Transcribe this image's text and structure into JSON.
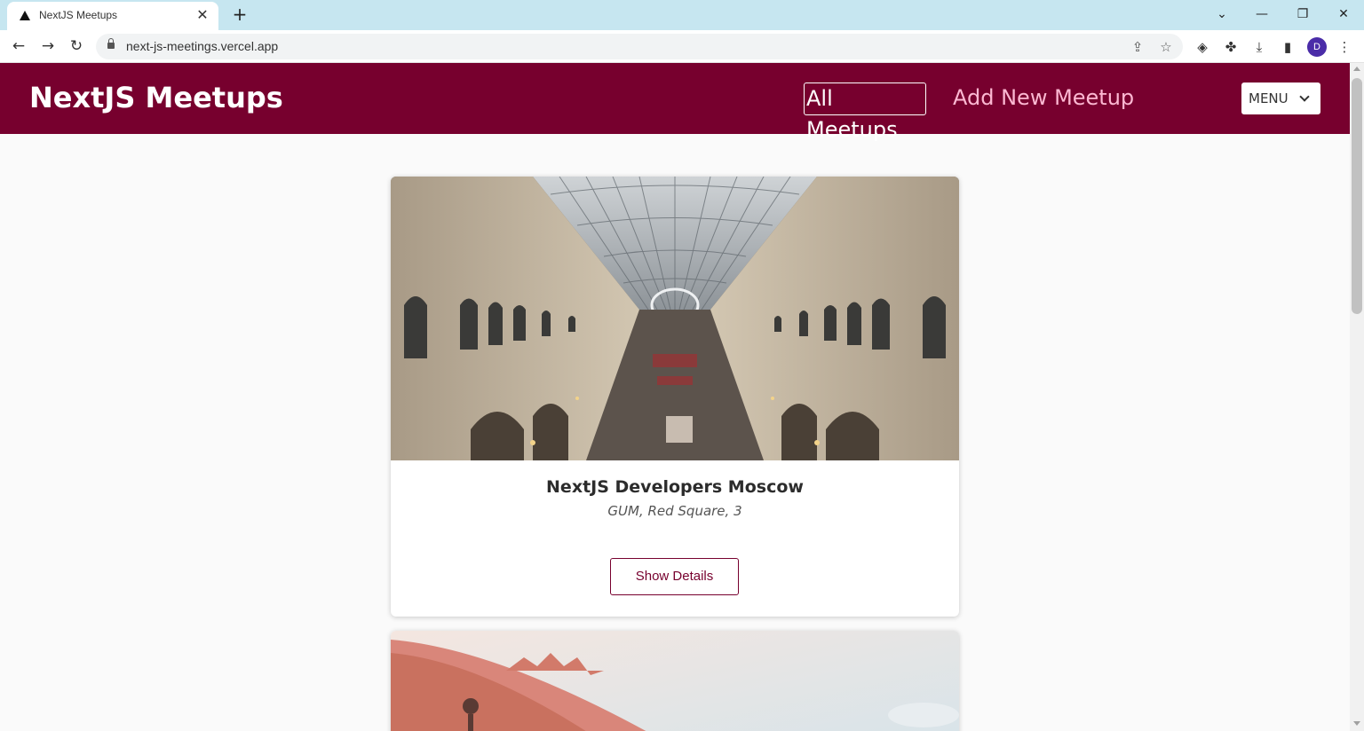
{
  "browser": {
    "tab_title": "NextJS Meetups",
    "tab_close_glyph": "✕",
    "new_tab_glyph": "+",
    "url": "next-js-meetings.vercel.app",
    "avatar_letter": "D",
    "icons": [
      "back-icon",
      "forward-icon",
      "reload-icon",
      "lock-icon",
      "share-icon",
      "star-icon",
      "extension-icon",
      "puzzle-icon",
      "download-icon",
      "sidepanel-icon",
      "kebab-menu-icon"
    ]
  },
  "header": {
    "logo": "NextJS Meetups",
    "nav": [
      {
        "label": "All Meetups",
        "active": true
      },
      {
        "label": "Add New Meetup",
        "active": false
      }
    ],
    "menu_label": "MENU"
  },
  "meetups": [
    {
      "title": "NextJS Developers Moscow",
      "address": "GUM, Red Square, 3",
      "button_label": "Show Details",
      "image": "arched-glass-roof-shopping-gallery"
    },
    {
      "image": "pink-ornate-building-facade"
    }
  ],
  "colors": {
    "brand": "#77002e",
    "nav_inactive": "#fcb8d2",
    "background": "#fafafa"
  }
}
